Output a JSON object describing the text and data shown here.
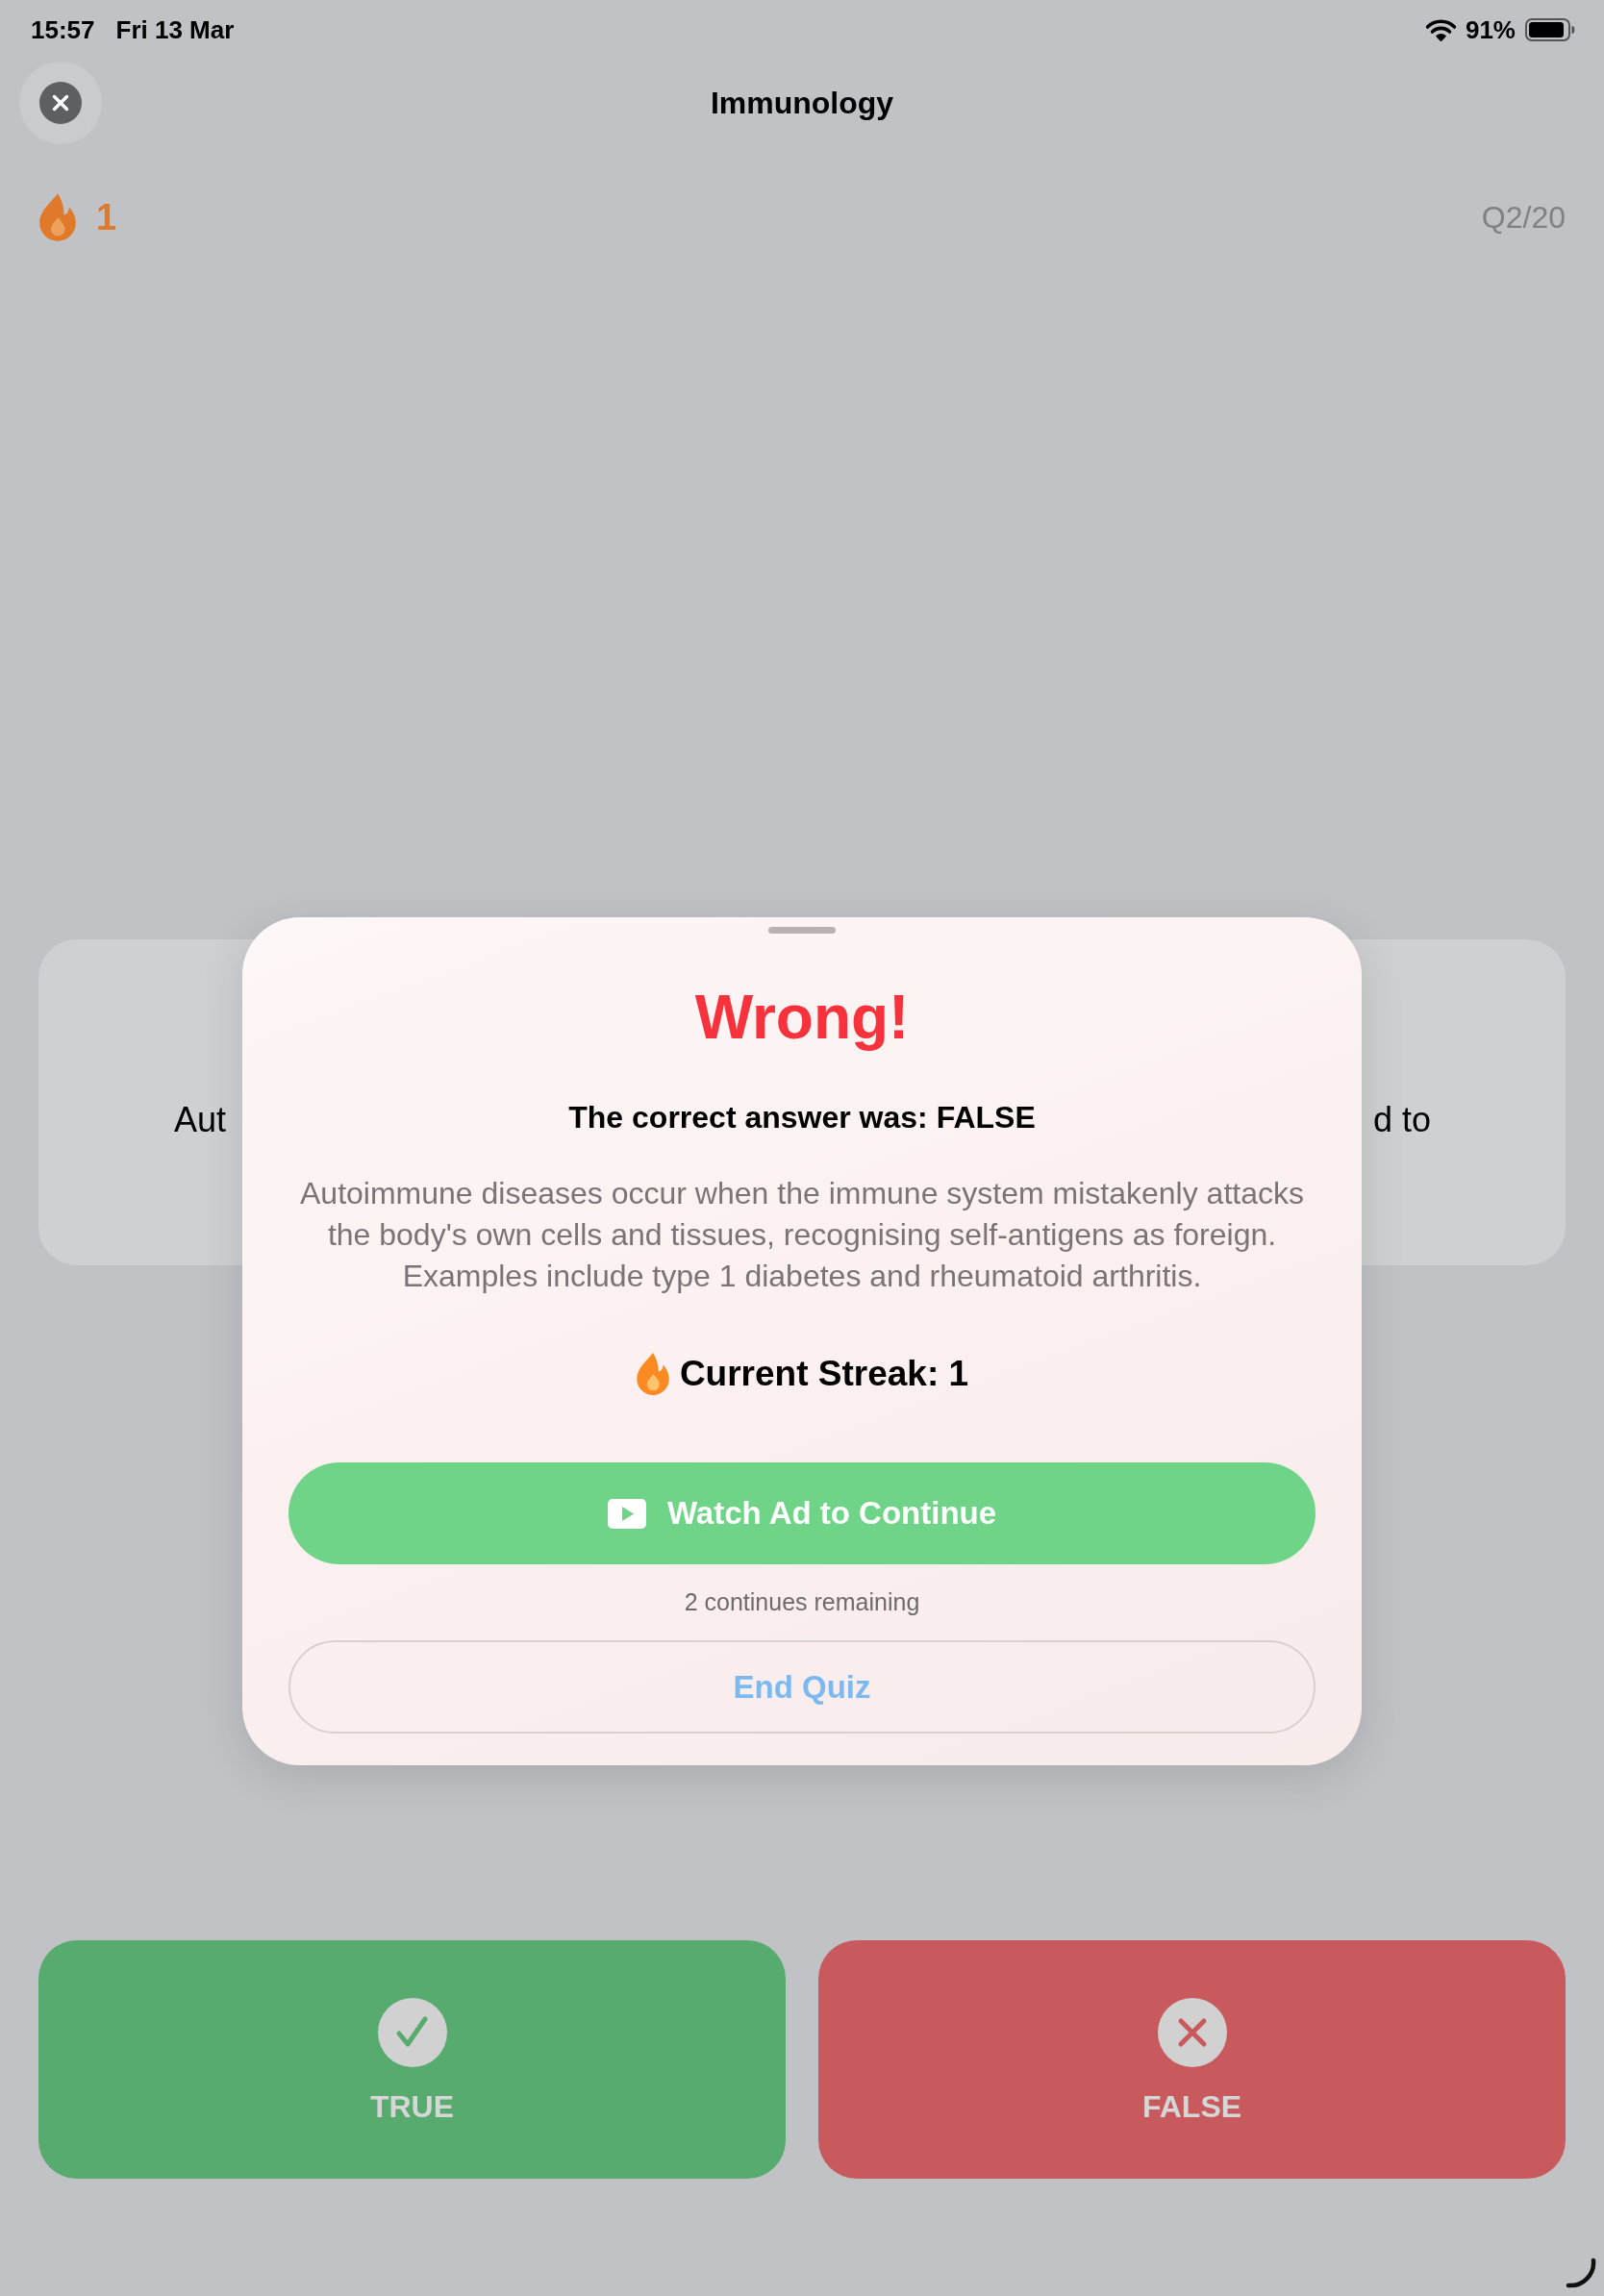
{
  "status_bar": {
    "time": "15:57",
    "date": "Fri 13 Mar",
    "battery": "91%"
  },
  "header": {
    "title": "Immunology"
  },
  "progress": {
    "streak": "1",
    "question": "Q2/20"
  },
  "question_card": {
    "fragments": [
      "Aut",
      "d to"
    ]
  },
  "result_sheet": {
    "title": "Wrong!",
    "correct_answer": "The correct answer was: FALSE",
    "explanation": "Autoimmune diseases occur when the immune system mistakenly attacks the body's own cells and tissues, recognising self-antigens as foreign. Examples include type 1 diabetes and rheumatoid arthritis.",
    "streak": "Current Streak: 1",
    "continue_button": "Watch Ad to Continue",
    "continues_remaining": "2 continues remaining",
    "end_button": "End Quiz"
  },
  "answer_buttons": [
    {
      "kind": "true",
      "label": "TRUE"
    },
    {
      "kind": "false",
      "label": "FALSE"
    }
  ]
}
